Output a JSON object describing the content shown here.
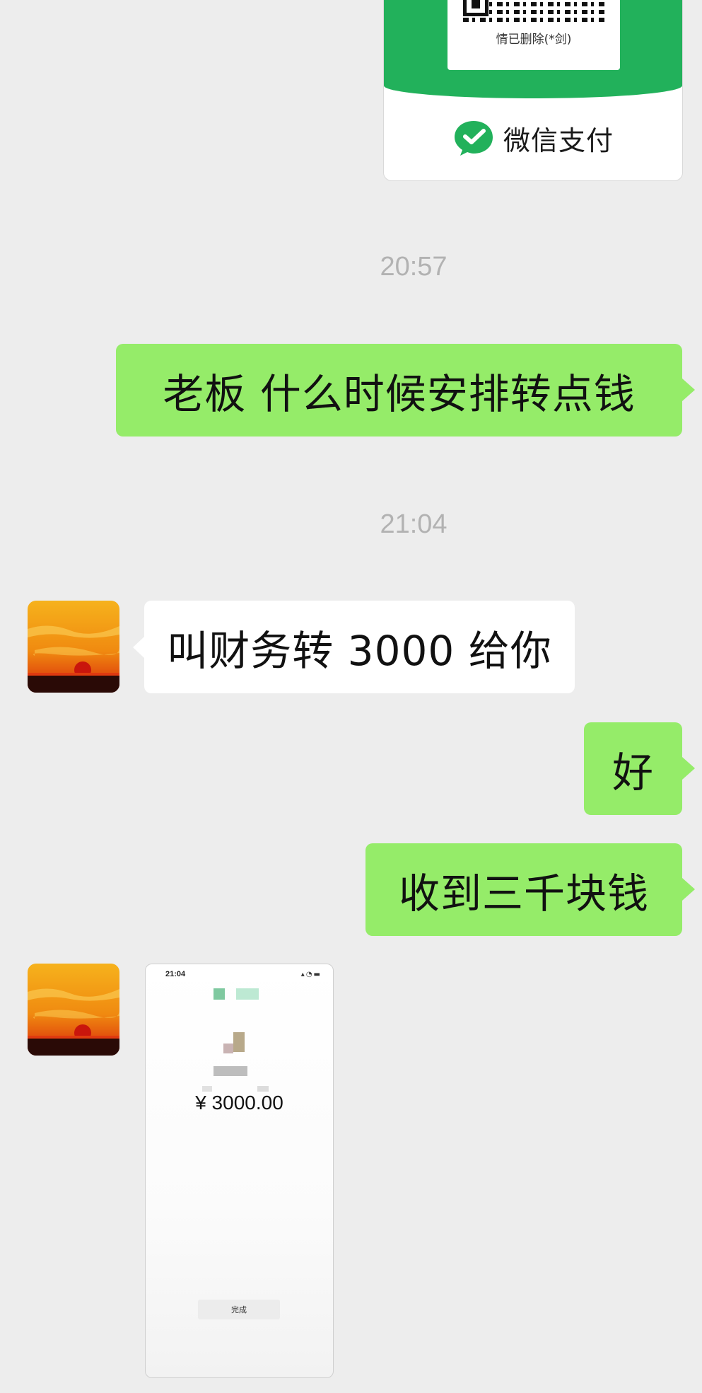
{
  "qr_card": {
    "caption": "情已删除(*剑)",
    "pay_label": "微信支付",
    "pay_icon": "wechat-pay-check-icon"
  },
  "timestamps": [
    "20:57",
    "21:04"
  ],
  "messages": [
    {
      "side": "sent",
      "text": "老板  什么时候安排转点钱"
    },
    {
      "side": "received",
      "text": "叫财务转 3000 给你"
    },
    {
      "side": "sent",
      "text": "好"
    },
    {
      "side": "sent",
      "text": "收到三千块钱"
    }
  ],
  "image_message": {
    "status_time": "21:04",
    "amount": "¥ 3000.00",
    "button_label": "完成"
  },
  "colors": {
    "background": "#ededed",
    "sent_bubble": "#95ec69",
    "received_bubble": "#ffffff",
    "wechat_green": "#22b15b",
    "timestamp": "#b2b2b2"
  }
}
